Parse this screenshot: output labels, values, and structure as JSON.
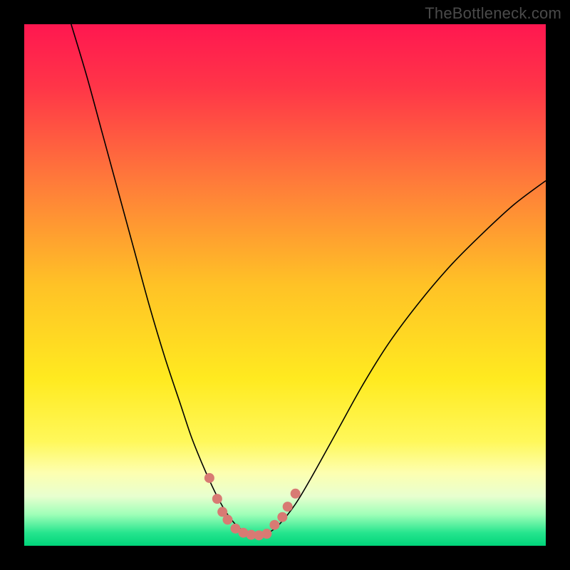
{
  "watermark": "TheBottleneck.com",
  "chart_data": {
    "type": "line",
    "title": "",
    "xlabel": "",
    "ylabel": "",
    "xlim": [
      0,
      100
    ],
    "ylim": [
      0,
      100
    ],
    "grid": false,
    "legend": false,
    "background": {
      "type": "vertical-gradient",
      "stops": [
        {
          "pos": 0.0,
          "color": "#ff1750"
        },
        {
          "pos": 0.12,
          "color": "#ff3548"
        },
        {
          "pos": 0.3,
          "color": "#ff7a3a"
        },
        {
          "pos": 0.5,
          "color": "#ffc226"
        },
        {
          "pos": 0.68,
          "color": "#ffea20"
        },
        {
          "pos": 0.8,
          "color": "#fff85a"
        },
        {
          "pos": 0.86,
          "color": "#fdffb0"
        },
        {
          "pos": 0.905,
          "color": "#e8ffcf"
        },
        {
          "pos": 0.94,
          "color": "#9fffb8"
        },
        {
          "pos": 0.975,
          "color": "#26e58e"
        },
        {
          "pos": 1.0,
          "color": "#00d47a"
        }
      ]
    },
    "series": [
      {
        "name": "bottleneck-curve",
        "color": "#000000",
        "width": 1.6,
        "x": [
          9.0,
          12.0,
          15.0,
          18.0,
          21.0,
          24.0,
          27.0,
          30.0,
          32.0,
          34.0,
          36.0,
          37.5,
          39.0,
          41.0,
          43.0,
          45.0,
          47.0,
          49.0,
          52.0,
          55.0,
          60.0,
          65.0,
          70.0,
          76.0,
          82.0,
          88.0,
          94.0,
          100.0
        ],
        "y": [
          100.0,
          90.0,
          79.0,
          68.0,
          57.0,
          46.0,
          36.0,
          27.0,
          21.0,
          16.0,
          11.5,
          8.5,
          6.0,
          3.6,
          2.4,
          2.0,
          2.6,
          4.2,
          8.0,
          13.0,
          22.0,
          31.0,
          39.0,
          47.0,
          54.0,
          60.0,
          65.5,
          70.0
        ]
      },
      {
        "name": "marker-dots",
        "type": "scatter",
        "color": "#d87a73",
        "radius": 7,
        "points": [
          {
            "x": 35.5,
            "y": 13.0
          },
          {
            "x": 37.0,
            "y": 9.0
          },
          {
            "x": 38.0,
            "y": 6.5
          },
          {
            "x": 39.0,
            "y": 5.0
          },
          {
            "x": 40.5,
            "y": 3.3
          },
          {
            "x": 42.0,
            "y": 2.5
          },
          {
            "x": 43.5,
            "y": 2.1
          },
          {
            "x": 45.0,
            "y": 2.0
          },
          {
            "x": 46.5,
            "y": 2.3
          },
          {
            "x": 48.0,
            "y": 4.0
          },
          {
            "x": 49.5,
            "y": 5.5
          },
          {
            "x": 50.5,
            "y": 7.5
          },
          {
            "x": 52.0,
            "y": 10.0
          }
        ]
      }
    ]
  }
}
